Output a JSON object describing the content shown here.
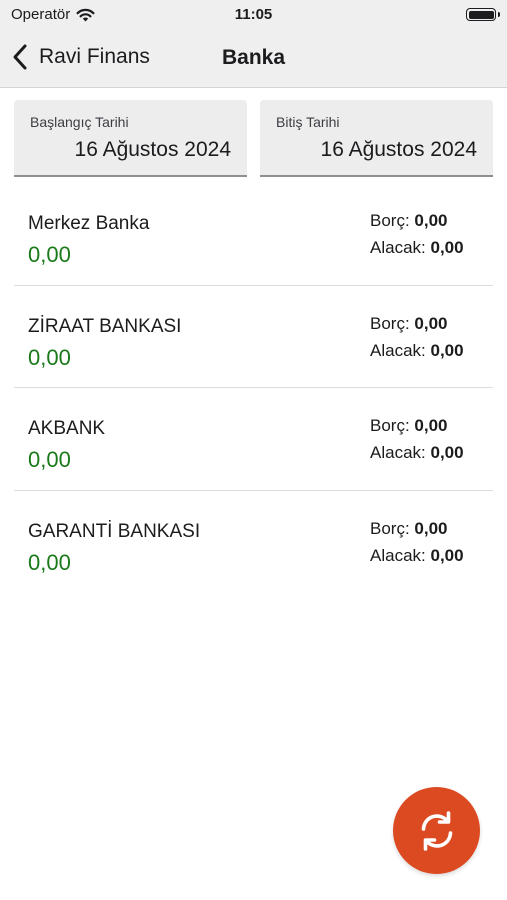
{
  "status_bar": {
    "carrier": "Operatör",
    "time": "11:05"
  },
  "nav": {
    "back_label": "Ravi Finans",
    "title": "Banka"
  },
  "filters": {
    "start": {
      "label": "Başlangıç Tarihi",
      "value": "16 Ağustos 2024"
    },
    "end": {
      "label": "Bitiş Tarihi",
      "value": "16 Ağustos 2024"
    }
  },
  "accounts": [
    {
      "name": "Merkez Banka",
      "balance": "0,00",
      "debt_label": "Borç:",
      "debt": "0,00",
      "credit_label": "Alacak:",
      "credit": "0,00"
    },
    {
      "name": "ZİRAAT BANKASI",
      "balance": "0,00",
      "debt_label": "Borç:",
      "debt": "0,00",
      "credit_label": "Alacak:",
      "credit": "0,00"
    },
    {
      "name": "AKBANK",
      "balance": "0,00",
      "debt_label": "Borç:",
      "debt": "0,00",
      "credit_label": "Alacak:",
      "credit": "0,00"
    },
    {
      "name": "GARANTİ BANKASI",
      "balance": "0,00",
      "debt_label": "Borç:",
      "debt": "0,00",
      "credit_label": "Alacak:",
      "credit": "0,00"
    }
  ],
  "icons": {
    "back": "chevron-left-icon",
    "refresh": "refresh-icon",
    "wifi": "wifi-icon",
    "battery": "battery-icon"
  },
  "colors": {
    "accent": "#dc4a22",
    "balance": "#1a7a1a",
    "bar_background": "#efeff0"
  }
}
